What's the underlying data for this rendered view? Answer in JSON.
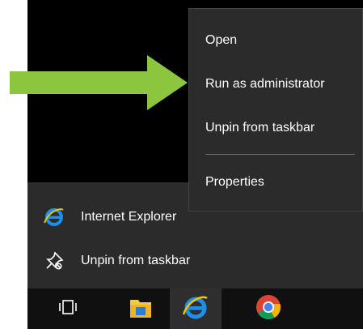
{
  "context_menu": {
    "items": [
      "Open",
      "Run as administrator",
      "Unpin from taskbar",
      "Properties"
    ]
  },
  "jump_list": {
    "items": [
      {
        "label": "Internet Explorer",
        "icon": "internet-explorer-icon"
      },
      {
        "label": "Unpin from taskbar",
        "icon": "unpin-icon"
      }
    ]
  },
  "taskbar": {
    "buttons": [
      {
        "icon": "task-view-icon"
      },
      {
        "icon": "file-explorer-icon"
      },
      {
        "icon": "internet-explorer-icon",
        "active": true
      },
      {
        "icon": "chrome-icon"
      }
    ]
  },
  "annotation": {
    "icon": "arrow-right-icon",
    "color": "#8cc63f"
  },
  "colors": {
    "accent_ie": "#1e90e8",
    "jumplist_bg": "#2b2b2b",
    "desktop_bg": "#000000"
  }
}
